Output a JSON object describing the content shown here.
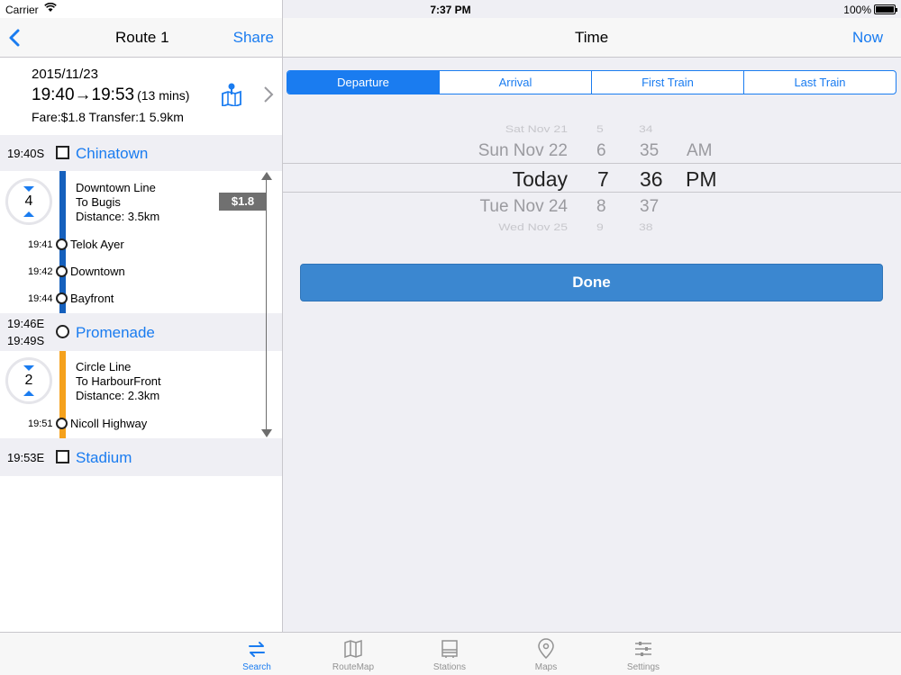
{
  "status_bar": {
    "carrier": "Carrier",
    "time": "7:37 PM",
    "battery": "100%"
  },
  "left_nav": {
    "title": "Route 1",
    "share": "Share"
  },
  "summary": {
    "date": "2015/11/23",
    "times": "19:40→19:53",
    "duration": "(13 mins)",
    "fare_transfer": "Fare:$1.8  Transfer:1  5.9km"
  },
  "stations": [
    {
      "time": "19:40S",
      "name": "Chinatown"
    },
    {
      "time_arr": "19:46E",
      "time_dep": "19:49S",
      "name": "Promenade"
    },
    {
      "time": "19:53E",
      "name": "Stadium"
    }
  ],
  "segments": [
    {
      "stops_count": "4",
      "line": "Downtown Line",
      "direction": "To Bugis",
      "distance": "Distance: 3.5km",
      "color": "#1560bd",
      "stops": [
        {
          "time": "19:41",
          "name": "Telok Ayer"
        },
        {
          "time": "19:42",
          "name": "Downtown"
        },
        {
          "time": "19:44",
          "name": "Bayfront"
        }
      ]
    },
    {
      "stops_count": "2",
      "line": "Circle Line",
      "direction": "To HarbourFront",
      "distance": "Distance: 2.3km",
      "color": "#f5a11c",
      "stops": [
        {
          "time": "19:51",
          "name": "Nicoll Highway"
        }
      ]
    }
  ],
  "fare_tag": "$1.8",
  "right_nav": {
    "title": "Time",
    "now": "Now"
  },
  "mode_tabs": [
    "Departure",
    "Arrival",
    "First Train",
    "Last Train"
  ],
  "mode_selected": "Departure",
  "picker": {
    "dates": [
      "Sat Nov 21",
      "Sun Nov 22",
      "Today",
      "Tue Nov 24",
      "Wed Nov 25"
    ],
    "hours": [
      "5",
      "6",
      "7",
      "8",
      "9"
    ],
    "minutes": [
      "34",
      "35",
      "36",
      "37",
      "38"
    ],
    "ampm": [
      "AM",
      "PM"
    ],
    "selected": {
      "date": "Today",
      "hour": "7",
      "minute": "36",
      "ampm": "PM"
    }
  },
  "done_button": "Done",
  "tab_bar": [
    {
      "label": "Search",
      "icon": "search-route-icon",
      "active": true
    },
    {
      "label": "RouteMap",
      "icon": "route-map-icon",
      "active": false
    },
    {
      "label": "Stations",
      "icon": "stations-icon",
      "active": false
    },
    {
      "label": "Maps",
      "icon": "maps-pin-icon",
      "active": false
    },
    {
      "label": "Settings",
      "icon": "settings-sliders-icon",
      "active": false
    }
  ],
  "colors": {
    "accent": "#1a7cf0",
    "done_button": "#3b87d0",
    "downtown_line": "#1560bd",
    "circle_line": "#f5a11c"
  }
}
